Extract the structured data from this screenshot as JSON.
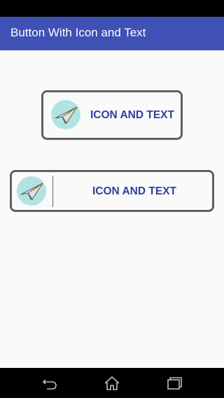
{
  "app_bar": {
    "title": "Button With Icon and Text"
  },
  "buttons": [
    {
      "label": "ICON AND TEXT",
      "icon": "paper-plane-icon",
      "has_divider": false
    },
    {
      "label": "ICON AND TEXT",
      "icon": "paper-plane-icon",
      "has_divider": true
    }
  ],
  "nav_bar": {
    "items": [
      "back-icon",
      "home-icon",
      "recent-apps-icon"
    ]
  },
  "colors": {
    "app_bar": "#3f51b5",
    "button_text": "#303f9f",
    "button_border": "#616161",
    "icon_background": "#b2e3e3",
    "background": "#fafafa"
  }
}
